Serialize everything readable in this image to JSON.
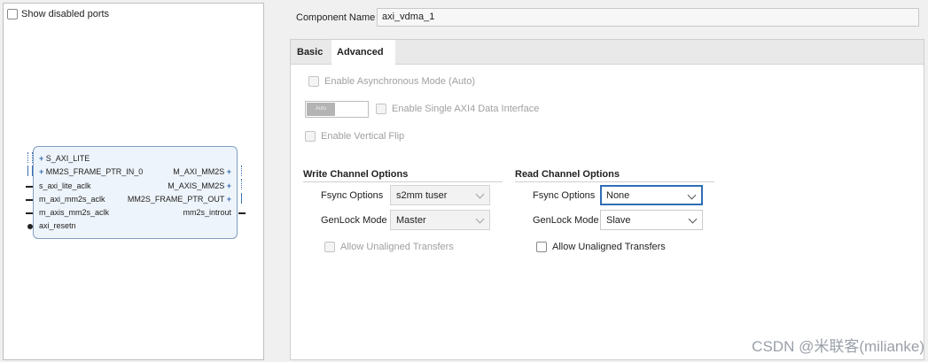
{
  "left_panel": {
    "show_disabled_ports_label": "Show disabled ports",
    "block": {
      "left_ports": [
        "S_AXI_LITE",
        "MM2S_FRAME_PTR_IN_0",
        "s_axi_lite_aclk",
        "m_axi_mm2s_aclk",
        "m_axis_mm2s_aclk",
        "axi_resetn"
      ],
      "right_ports": [
        "M_AXI_MM2S",
        "M_AXIS_MM2S",
        "MM2S_FRAME_PTR_OUT",
        "mm2s_introut"
      ]
    }
  },
  "component": {
    "label": "Component Name",
    "value": "axi_vdma_1"
  },
  "tabs": [
    {
      "label": "Basic",
      "active": false
    },
    {
      "label": "Advanced",
      "active": true
    }
  ],
  "advanced": {
    "async_mode_label": "Enable Asynchronous Mode (Auto)",
    "toggle_label": "Auto",
    "single_axi4_label": "Enable Single AXI4 Data Interface",
    "vertical_flip_label": "Enable Vertical Flip",
    "write": {
      "title": "Write Channel Options",
      "fsync_label": "Fsync Options",
      "fsync_value": "s2mm tuser",
      "genlock_label": "GenLock Mode",
      "genlock_value": "Master",
      "unaligned_label": "Allow Unaligned Transfers"
    },
    "read": {
      "title": "Read Channel Options",
      "fsync_label": "Fsync Options",
      "fsync_value": "None",
      "genlock_label": "GenLock Mode",
      "genlock_value": "Slave",
      "unaligned_label": "Allow Unaligned Transfers"
    }
  },
  "watermark": "CSDN @米联客(milianke)",
  "colors": {
    "accent": "#2f6db5",
    "block_border": "#7f9fc4",
    "block_fill": "#eef4fb"
  }
}
